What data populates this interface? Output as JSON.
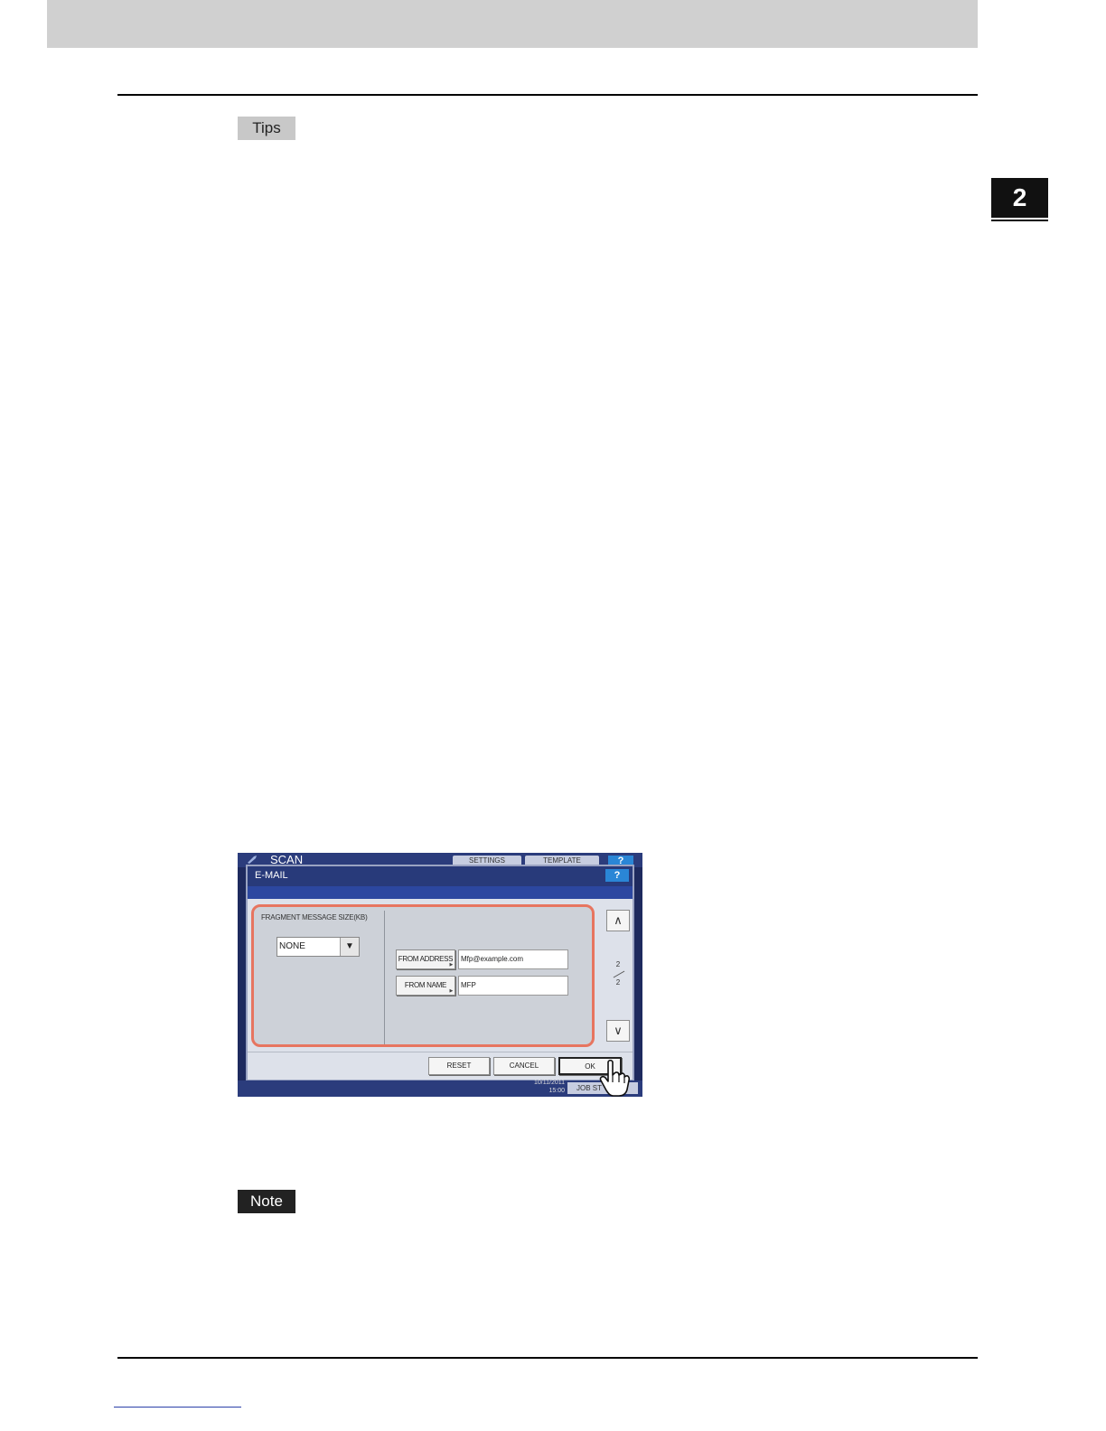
{
  "page": {
    "chapter_number": "2",
    "tips_label": "Tips",
    "note_label": "Note"
  },
  "screenshot": {
    "background": {
      "title": "SCAN",
      "settings_label": "SETTINGS",
      "template_label": "TEMPLATE",
      "help_label": "?",
      "date_text": "10/11/2011 15:00",
      "job_status_label": "JOB ST"
    },
    "dialog": {
      "title": "E-MAIL",
      "help_label": "?",
      "fragment_label": "FRAGMENT MESSAGE SIZE(KB)",
      "fragment_value": "NONE",
      "from_address_label": "FROM ADDRESS",
      "from_address_value": "Mfp@example.com",
      "from_name_label": "FROM NAME",
      "from_name_value": "MFP",
      "page_current": "2",
      "page_total": "2",
      "reset_label": "RESET",
      "cancel_label": "CANCEL",
      "ok_label": "OK"
    }
  }
}
